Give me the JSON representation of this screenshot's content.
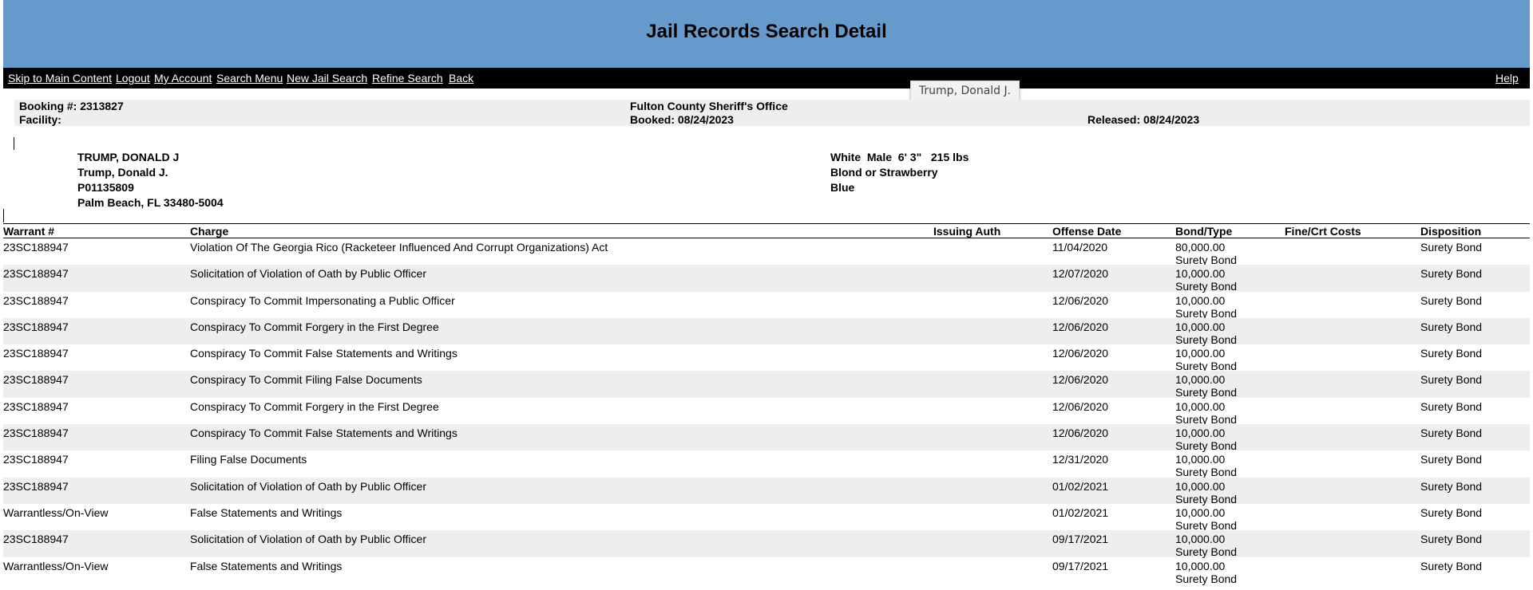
{
  "header": {
    "title": "Jail Records Search Detail"
  },
  "nav": {
    "skip": "Skip to Main Content",
    "logout": "Logout",
    "account": "My Account",
    "search_menu": "Search Menu",
    "new_search": "New Jail Search",
    "refine": "Refine Search",
    "back": "Back",
    "help": "Help"
  },
  "tooltip": "Trump, Donald J.",
  "booking": {
    "booking_no": "Booking #: 2313827",
    "facility": "Facility:",
    "agency": "Fulton County Sheriff's Office",
    "booked": "Booked: 08/24/2023",
    "released": "Released: 08/24/2023"
  },
  "person": {
    "name_upper": "TRUMP, DONALD J",
    "name": "Trump, Donald J.",
    "id": "P01135809",
    "city": "Palm Beach, FL 33480-5004",
    "descr": "White  Male  6' 3\"   215 lbs",
    "hair": "Blond or Strawberry",
    "eyes": "Blue"
  },
  "table": {
    "headers": {
      "warrant": "Warrant #",
      "charge": "Charge",
      "issuing": "Issuing Auth",
      "offense_date": "Offense Date",
      "bond": "Bond/Type",
      "fine": "Fine/Crt Costs",
      "disposition": "Disposition"
    },
    "rows": [
      {
        "warrant": "23SC188947",
        "charge": "Violation Of The Georgia Rico (Racketeer Influenced And Corrupt Organizations) Act",
        "date": "11/04/2020",
        "bond": "80,000.00",
        "bond_type": "Surety Bond",
        "disposition": "Surety Bond"
      },
      {
        "warrant": "23SC188947",
        "charge": "Solicitation of Violation of Oath by Public Officer",
        "date": "12/07/2020",
        "bond": "10,000.00",
        "bond_type": "Surety Bond",
        "disposition": "Surety Bond"
      },
      {
        "warrant": "23SC188947",
        "charge": "Conspiracy To Commit Impersonating a Public Officer",
        "date": "12/06/2020",
        "bond": "10,000.00",
        "bond_type": "Surety Bond",
        "disposition": "Surety Bond"
      },
      {
        "warrant": "23SC188947",
        "charge": "Conspiracy To Commit Forgery in the First Degree",
        "date": "12/06/2020",
        "bond": "10,000.00",
        "bond_type": "Surety Bond",
        "disposition": "Surety Bond"
      },
      {
        "warrant": "23SC188947",
        "charge": "Conspiracy To Commit False Statements and Writings",
        "date": "12/06/2020",
        "bond": "10,000.00",
        "bond_type": "Surety Bond",
        "disposition": "Surety Bond"
      },
      {
        "warrant": "23SC188947",
        "charge": "Conspiracy To Commit Filing False Documents",
        "date": "12/06/2020",
        "bond": "10,000.00",
        "bond_type": "Surety Bond",
        "disposition": "Surety Bond"
      },
      {
        "warrant": "23SC188947",
        "charge": "Conspiracy To Commit Forgery in the First Degree",
        "date": "12/06/2020",
        "bond": "10,000.00",
        "bond_type": "Surety Bond",
        "disposition": "Surety Bond"
      },
      {
        "warrant": "23SC188947",
        "charge": "Conspiracy To Commit False Statements and Writings",
        "date": "12/06/2020",
        "bond": "10,000.00",
        "bond_type": "Surety Bond",
        "disposition": "Surety Bond"
      },
      {
        "warrant": "23SC188947",
        "charge": "Filing False Documents",
        "date": "12/31/2020",
        "bond": "10,000.00",
        "bond_type": "Surety Bond",
        "disposition": "Surety Bond"
      },
      {
        "warrant": "23SC188947",
        "charge": "Solicitation of Violation of Oath by Public Officer",
        "date": "01/02/2021",
        "bond": "10,000.00",
        "bond_type": "Surety Bond",
        "disposition": "Surety Bond"
      },
      {
        "warrant": "Warrantless/On-View",
        "charge": "False Statements and Writings",
        "date": "01/02/2021",
        "bond": "10,000.00",
        "bond_type": "Surety Bond",
        "disposition": "Surety Bond"
      },
      {
        "warrant": "23SC188947",
        "charge": "Solicitation of Violation of Oath by Public Officer",
        "date": "09/17/2021",
        "bond": "10,000.00",
        "bond_type": "Surety Bond",
        "disposition": "Surety Bond"
      },
      {
        "warrant": "Warrantless/On-View",
        "charge": "False Statements and Writings",
        "date": "09/17/2021",
        "bond": "10,000.00",
        "bond_type": "Surety Bond",
        "disposition": "Surety Bond"
      }
    ]
  }
}
